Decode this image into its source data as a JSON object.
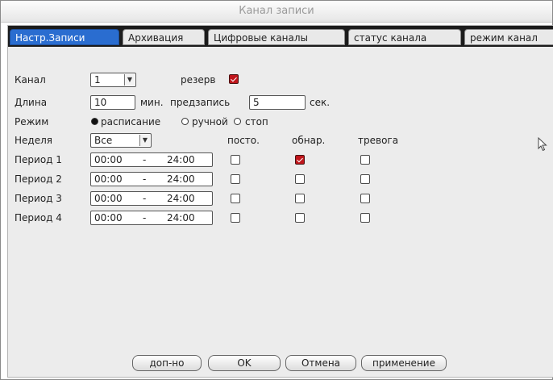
{
  "window": {
    "title": "Канал записи"
  },
  "tabs": [
    {
      "label": "Настр.Записи"
    },
    {
      "label": "Архивация"
    },
    {
      "label": "Цифровые каналы"
    },
    {
      "label": "статус канала"
    },
    {
      "label": "режим канал"
    }
  ],
  "form": {
    "channel_label": "Канал",
    "channel_value": "1",
    "backup_label": "резерв",
    "backup_checked": true,
    "length_label": "Длина",
    "length_value": "10",
    "length_unit": "мин.",
    "prerecord_label": "предзапись",
    "prerecord_value": "5",
    "prerecord_unit": "сек.",
    "mode_label": "Режим",
    "mode_options": [
      "расписание",
      "ручной",
      "стоп"
    ],
    "mode_selected": "расписание",
    "week_label": "Неделя",
    "week_value": "Все",
    "col_regular": "посто.",
    "col_detect": "обнар.",
    "col_alarm": "тревога"
  },
  "periods": [
    {
      "label": "Период 1",
      "start": "00:00",
      "sep": "-",
      "end": "24:00",
      "regular": false,
      "detect": true,
      "alarm": false
    },
    {
      "label": "Период 2",
      "start": "00:00",
      "sep": "-",
      "end": "24:00",
      "regular": false,
      "detect": false,
      "alarm": false
    },
    {
      "label": "Период 3",
      "start": "00:00",
      "sep": "-",
      "end": "24:00",
      "regular": false,
      "detect": false,
      "alarm": false
    },
    {
      "label": "Период 4",
      "start": "00:00",
      "sep": "-",
      "end": "24:00",
      "regular": false,
      "detect": false,
      "alarm": false
    }
  ],
  "buttons": {
    "advanced": "доп-но",
    "ok": "OK",
    "cancel": "Отмена",
    "apply": "применение"
  },
  "colors": {
    "active_tab": "#2a6dd0",
    "checked": "#c0161c",
    "panel": "#ececec",
    "tabstrip": "#1c1c1c"
  }
}
